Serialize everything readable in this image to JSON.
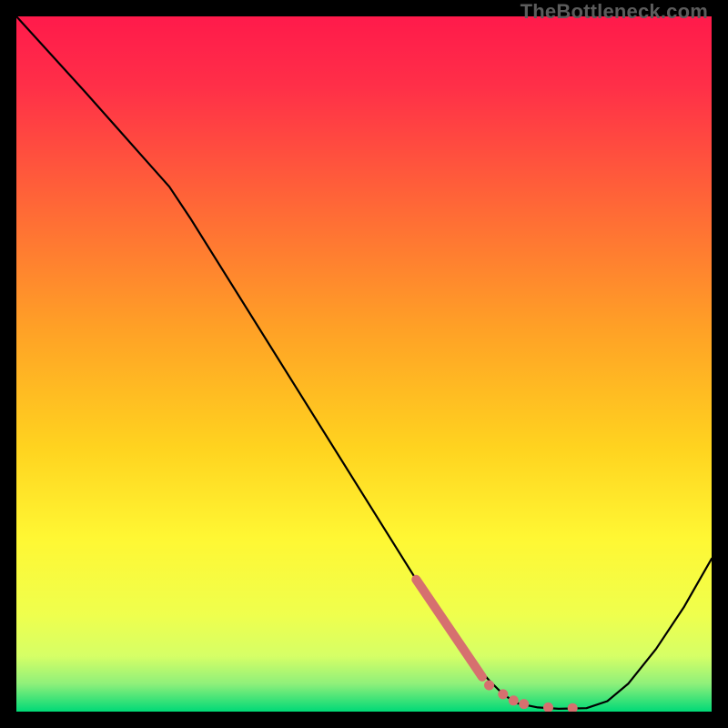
{
  "watermark": "TheBottleneck.com",
  "chart_data": {
    "type": "line",
    "title": "",
    "xlabel": "",
    "ylabel": "",
    "xlim": [
      0,
      100
    ],
    "ylim": [
      0,
      100
    ],
    "grid": false,
    "background_gradient_top": "#ff1a4b",
    "background_gradient_mid_a": "#ffa126",
    "background_gradient_mid_b": "#fff733",
    "background_gradient_low": "#e8ff66",
    "background_gradient_bottom": "#00d977",
    "series": [
      {
        "name": "curve",
        "stroke": "#000000",
        "values_xy": [
          [
            0,
            100
          ],
          [
            10,
            89
          ],
          [
            18,
            80
          ],
          [
            22,
            75.5
          ],
          [
            25,
            71
          ],
          [
            30,
            63
          ],
          [
            40,
            47
          ],
          [
            50,
            31
          ],
          [
            55,
            23
          ],
          [
            60,
            15
          ],
          [
            64,
            9
          ],
          [
            68,
            4.5
          ],
          [
            70,
            2.5
          ],
          [
            72,
            1.2
          ],
          [
            75,
            0.6
          ],
          [
            78,
            0.4
          ],
          [
            82,
            0.5
          ],
          [
            85,
            1.5
          ],
          [
            88,
            4
          ],
          [
            92,
            9
          ],
          [
            96,
            15
          ],
          [
            100,
            22
          ]
        ]
      },
      {
        "name": "highlight-segment",
        "stroke": "#d6706f",
        "values_xy": [
          [
            57.5,
            19
          ],
          [
            67,
            5
          ]
        ]
      }
    ],
    "markers": {
      "name": "highlight-dots",
      "color": "#d6706f",
      "values_xy": [
        [
          68,
          3.8
        ],
        [
          70,
          2.5
        ],
        [
          71.5,
          1.6
        ],
        [
          73,
          1.1
        ],
        [
          76.5,
          0.6
        ],
        [
          80,
          0.5
        ]
      ]
    }
  }
}
